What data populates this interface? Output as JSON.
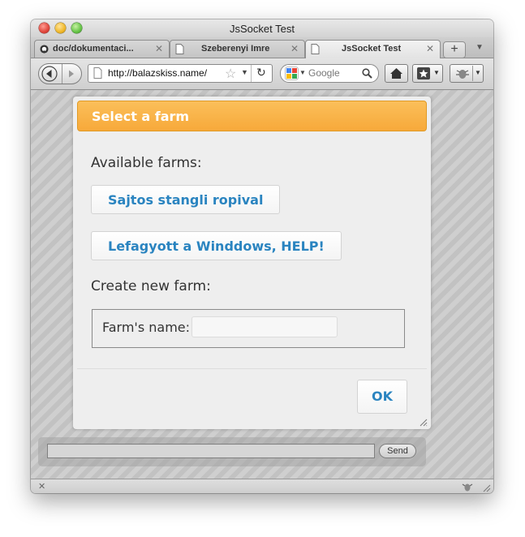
{
  "window": {
    "title": "JsSocket Test"
  },
  "tabs": [
    {
      "label": "doc/dokumentaci...",
      "icon": "github-icon",
      "active": false
    },
    {
      "label": "Szeberenyi Imre",
      "icon": "page-icon",
      "active": false
    },
    {
      "label": "JsSocket Test",
      "icon": "page-icon",
      "active": true
    }
  ],
  "tab_close_glyph": "✕",
  "new_tab_glyph": "+",
  "navbar": {
    "url": "http://balazskiss.name/",
    "search_placeholder": "Google"
  },
  "dialog": {
    "title": "Select a farm",
    "available_label": "Available farms:",
    "farms": [
      "Sajtos stangli ropival",
      "Lefagyott a Winddows, HELP!"
    ],
    "create_label": "Create new farm:",
    "name_label": "Farm's name:",
    "name_value": "",
    "ok_label": "OK"
  },
  "chat": {
    "message_value": "",
    "send_label": "Send"
  },
  "colors": {
    "header_orange": "#f7a93a",
    "link_blue": "#2a84c0"
  }
}
